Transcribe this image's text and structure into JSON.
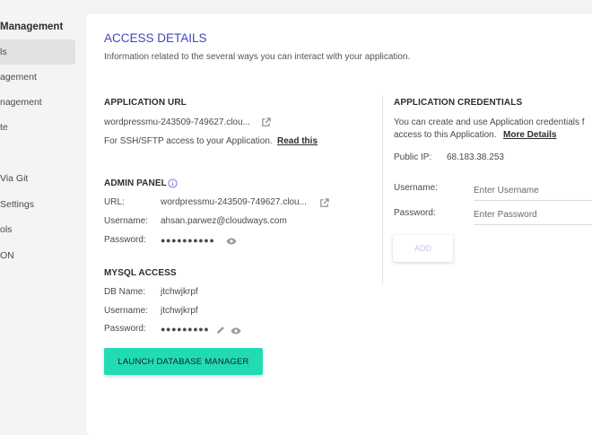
{
  "sidebar": {
    "heading": "Management",
    "items": [
      "ls",
      "agement",
      "nagement",
      "te",
      "Via Git",
      "Settings",
      "ols",
      "ON"
    ]
  },
  "access": {
    "title": "ACCESS DETAILS",
    "subtitle": "Information related to the several ways you can interact with your application."
  },
  "app_url": {
    "title": "APPLICATION URL",
    "url": "wordpressmu-243509-749627.clou...",
    "ssh_text": "For SSH/SFTP access to your Application.",
    "ssh_link": "Read this"
  },
  "admin_panel": {
    "title": "ADMIN PANEL",
    "url_label": "URL:",
    "url_value": "wordpressmu-243509-749627.clou...",
    "username_label": "Username:",
    "username_value": "ahsan.parwez@cloudways.com",
    "password_label": "Password:",
    "password_value": "●●●●●●●●●●"
  },
  "mysql": {
    "title": "MYSQL ACCESS",
    "dbname_label": "DB Name:",
    "dbname_value": "jtchwjkrpf",
    "username_label": "Username:",
    "username_value": "jtchwjkrpf",
    "password_label": "Password:",
    "password_value": "●●●●●●●●●",
    "launch_label": "LAUNCH DATABASE MANAGER"
  },
  "credentials": {
    "title": "APPLICATION CREDENTIALS",
    "desc_line1": "You can create and use Application credentials f",
    "desc_line2": "access to this Application.",
    "more_link": "More Details",
    "public_ip_label": "Public IP:",
    "public_ip_value": "68.183.38.253",
    "username_label": "Username:",
    "username_placeholder": "Enter Username",
    "password_label": "Password:",
    "password_placeholder": "Enter Password",
    "add_label": "ADD"
  },
  "colors": {
    "accent": "#3f48b8",
    "launch_button": "#21dcb2"
  }
}
